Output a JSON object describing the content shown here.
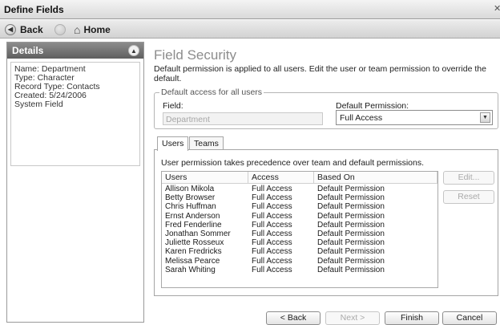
{
  "window": {
    "title": "Define Fields"
  },
  "nav": {
    "back_label": "Back",
    "home_label": "Home"
  },
  "details": {
    "title": "Details",
    "lines": [
      "Name: Department",
      "Type: Character",
      "Record Type: Contacts",
      "Created: 5/24/2006",
      "System Field"
    ]
  },
  "main": {
    "title": "Field Security",
    "intro": "Default permission is applied to all users. Edit the user or team permission to override the default."
  },
  "default_access": {
    "legend": "Default access for all users",
    "field_label": "Field:",
    "field_value": "Department",
    "permission_label": "Default Permission:",
    "permission_value": "Full Access"
  },
  "tabs": [
    {
      "label": "Users"
    },
    {
      "label": "Teams"
    }
  ],
  "users_tab": {
    "note": "User permission takes precedence over team and default permissions.",
    "columns": [
      "Users",
      "Access",
      "Based On"
    ],
    "rows": [
      [
        "Allison Mikola",
        "Full Access",
        "Default Permission"
      ],
      [
        "Betty Browser",
        "Full Access",
        "Default Permission"
      ],
      [
        "Chris Huffman",
        "Full Access",
        "Default Permission"
      ],
      [
        "Ernst Anderson",
        "Full Access",
        "Default Permission"
      ],
      [
        "Fred Fenderline",
        "Full Access",
        "Default Permission"
      ],
      [
        "Jonathan Sommer",
        "Full Access",
        "Default Permission"
      ],
      [
        "Juliette Rosseux",
        "Full Access",
        "Default Permission"
      ],
      [
        "Karen Fredricks",
        "Full Access",
        "Default Permission"
      ],
      [
        "Melissa Pearce",
        "Full Access",
        "Default Permission"
      ],
      [
        "Sarah Whiting",
        "Full Access",
        "Default Permission"
      ]
    ],
    "edit_label": "Edit...",
    "reset_label": "Reset"
  },
  "footer": {
    "back": "< Back",
    "next": "Next >",
    "finish": "Finish",
    "cancel": "Cancel"
  }
}
